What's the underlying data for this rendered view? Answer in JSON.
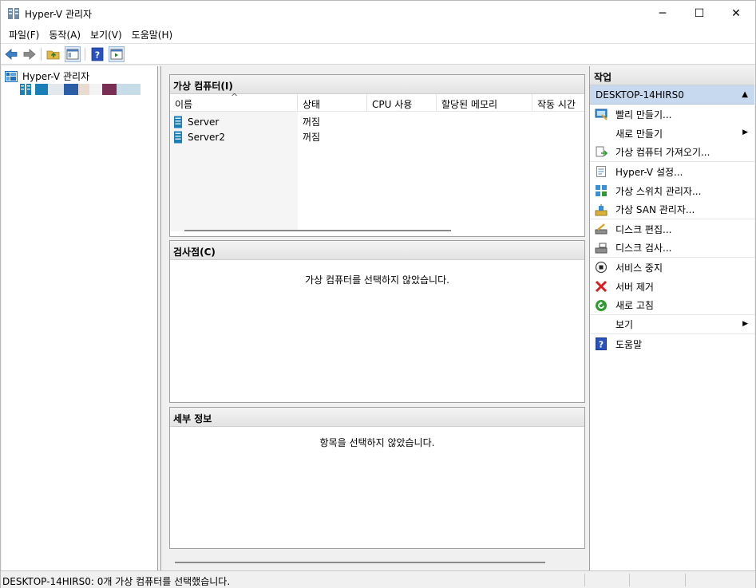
{
  "window": {
    "title": "Hyper-V 관리자",
    "min": "─",
    "max": "☐",
    "close": "✕"
  },
  "menu": [
    "파일(F)",
    "동작(A)",
    "보기(V)",
    "도움말(H)"
  ],
  "tree": {
    "root": "Hyper-V 관리자",
    "child_colors": [
      "#1b7fb7",
      "#e2e8ec",
      "#2c5ea8",
      "#e9dccf",
      "#f3f3f3",
      "#7a2e54",
      "#c6dde8"
    ]
  },
  "vm_panel": {
    "title": "가상 컴퓨터(I)",
    "columns": [
      "이름",
      "상태",
      "CPU 사용",
      "할당된 메모리",
      "작동 시간"
    ],
    "sort_glyph": "^",
    "rows": [
      {
        "name": "Server",
        "state": "꺼짐"
      },
      {
        "name": "Server2",
        "state": "꺼짐"
      }
    ]
  },
  "checkpoint_panel": {
    "title": "검사점(C)",
    "message": "가상 컴퓨터를 선택하지 않았습니다."
  },
  "details_panel": {
    "title": "세부 정보",
    "message": "항목을 선택하지 않았습니다."
  },
  "actions": {
    "header": "작업",
    "group": "DESKTOP-14HIRS0",
    "group_glyph": "▲",
    "items": [
      {
        "label": "빨리 만들기...",
        "icon": "quick-create-icon"
      },
      {
        "label": "새로 만들기",
        "icon": "none",
        "submenu": true
      },
      {
        "label": "가상 컴퓨터 가져오기...",
        "icon": "import-vm-icon",
        "sep": true
      },
      {
        "label": "Hyper-V 설정...",
        "icon": "settings-page-icon"
      },
      {
        "label": "가상 스위치 관리자...",
        "icon": "virtual-switch-icon"
      },
      {
        "label": "가상 SAN 관리자...",
        "icon": "san-icon",
        "sep": true
      },
      {
        "label": "디스크 편집...",
        "icon": "edit-disk-icon"
      },
      {
        "label": "디스크 검사...",
        "icon": "inspect-disk-icon",
        "sep": true
      },
      {
        "label": "서비스 중지",
        "icon": "stop-service-icon"
      },
      {
        "label": "서버 제거",
        "icon": "remove-server-icon"
      },
      {
        "label": "새로 고침",
        "icon": "refresh-icon",
        "sep": true
      },
      {
        "label": "보기",
        "icon": "none",
        "submenu": true,
        "sep": true
      },
      {
        "label": "도움말",
        "icon": "help-icon"
      }
    ]
  },
  "status": "DESKTOP-14HIRS0:  0개 가상 컴퓨터를 선택했습니다.",
  "colors": {
    "action_group_bg": "#c7d9ee",
    "accent_blue": "#1b6fc2"
  }
}
